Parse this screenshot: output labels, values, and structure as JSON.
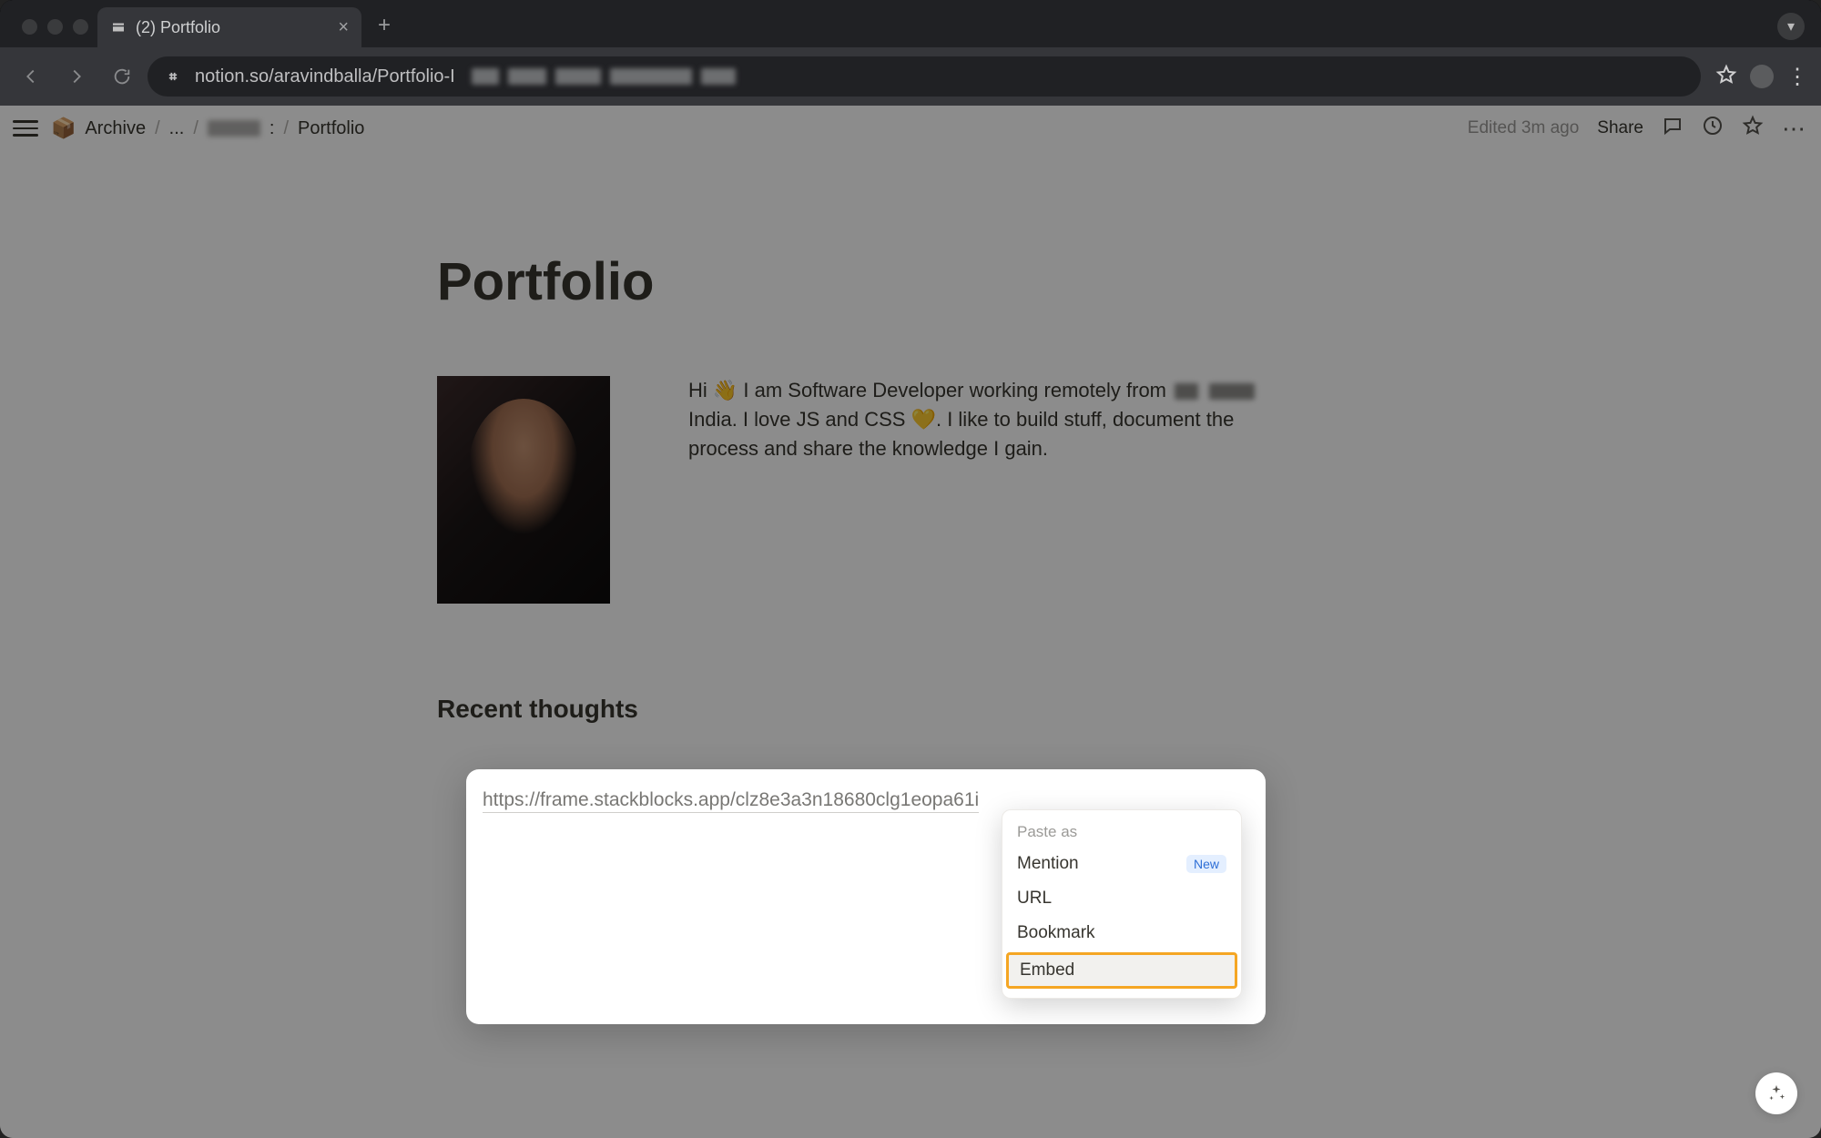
{
  "browser": {
    "tab_title": "(2) Portfolio",
    "url": "notion.so/aravindballa/Portfolio-I",
    "new_tab_label": "+",
    "chevron_label": "▾"
  },
  "topbar": {
    "breadcrumbs": {
      "icon": "📦",
      "root": "Archive",
      "mid": "...",
      "colon": ":",
      "current": "Portfolio"
    },
    "edited": "Edited 3m ago",
    "share": "Share"
  },
  "page": {
    "title": "Portfolio",
    "intro_before": "Hi 👋 I am Software Developer working remotely from ",
    "intro_after": " India. I love JS and CSS 💛. I like to build stuff, document the process and share the knowledge I gain.",
    "section_heading": "Recent thoughts"
  },
  "paste": {
    "url": "https://frame.stackblocks.app/clz8e3a3n18680clg1eopa61i",
    "menu_header": "Paste as",
    "options": {
      "mention": "Mention",
      "url": "URL",
      "bookmark": "Bookmark",
      "embed": "Embed"
    },
    "new_badge": "New"
  }
}
